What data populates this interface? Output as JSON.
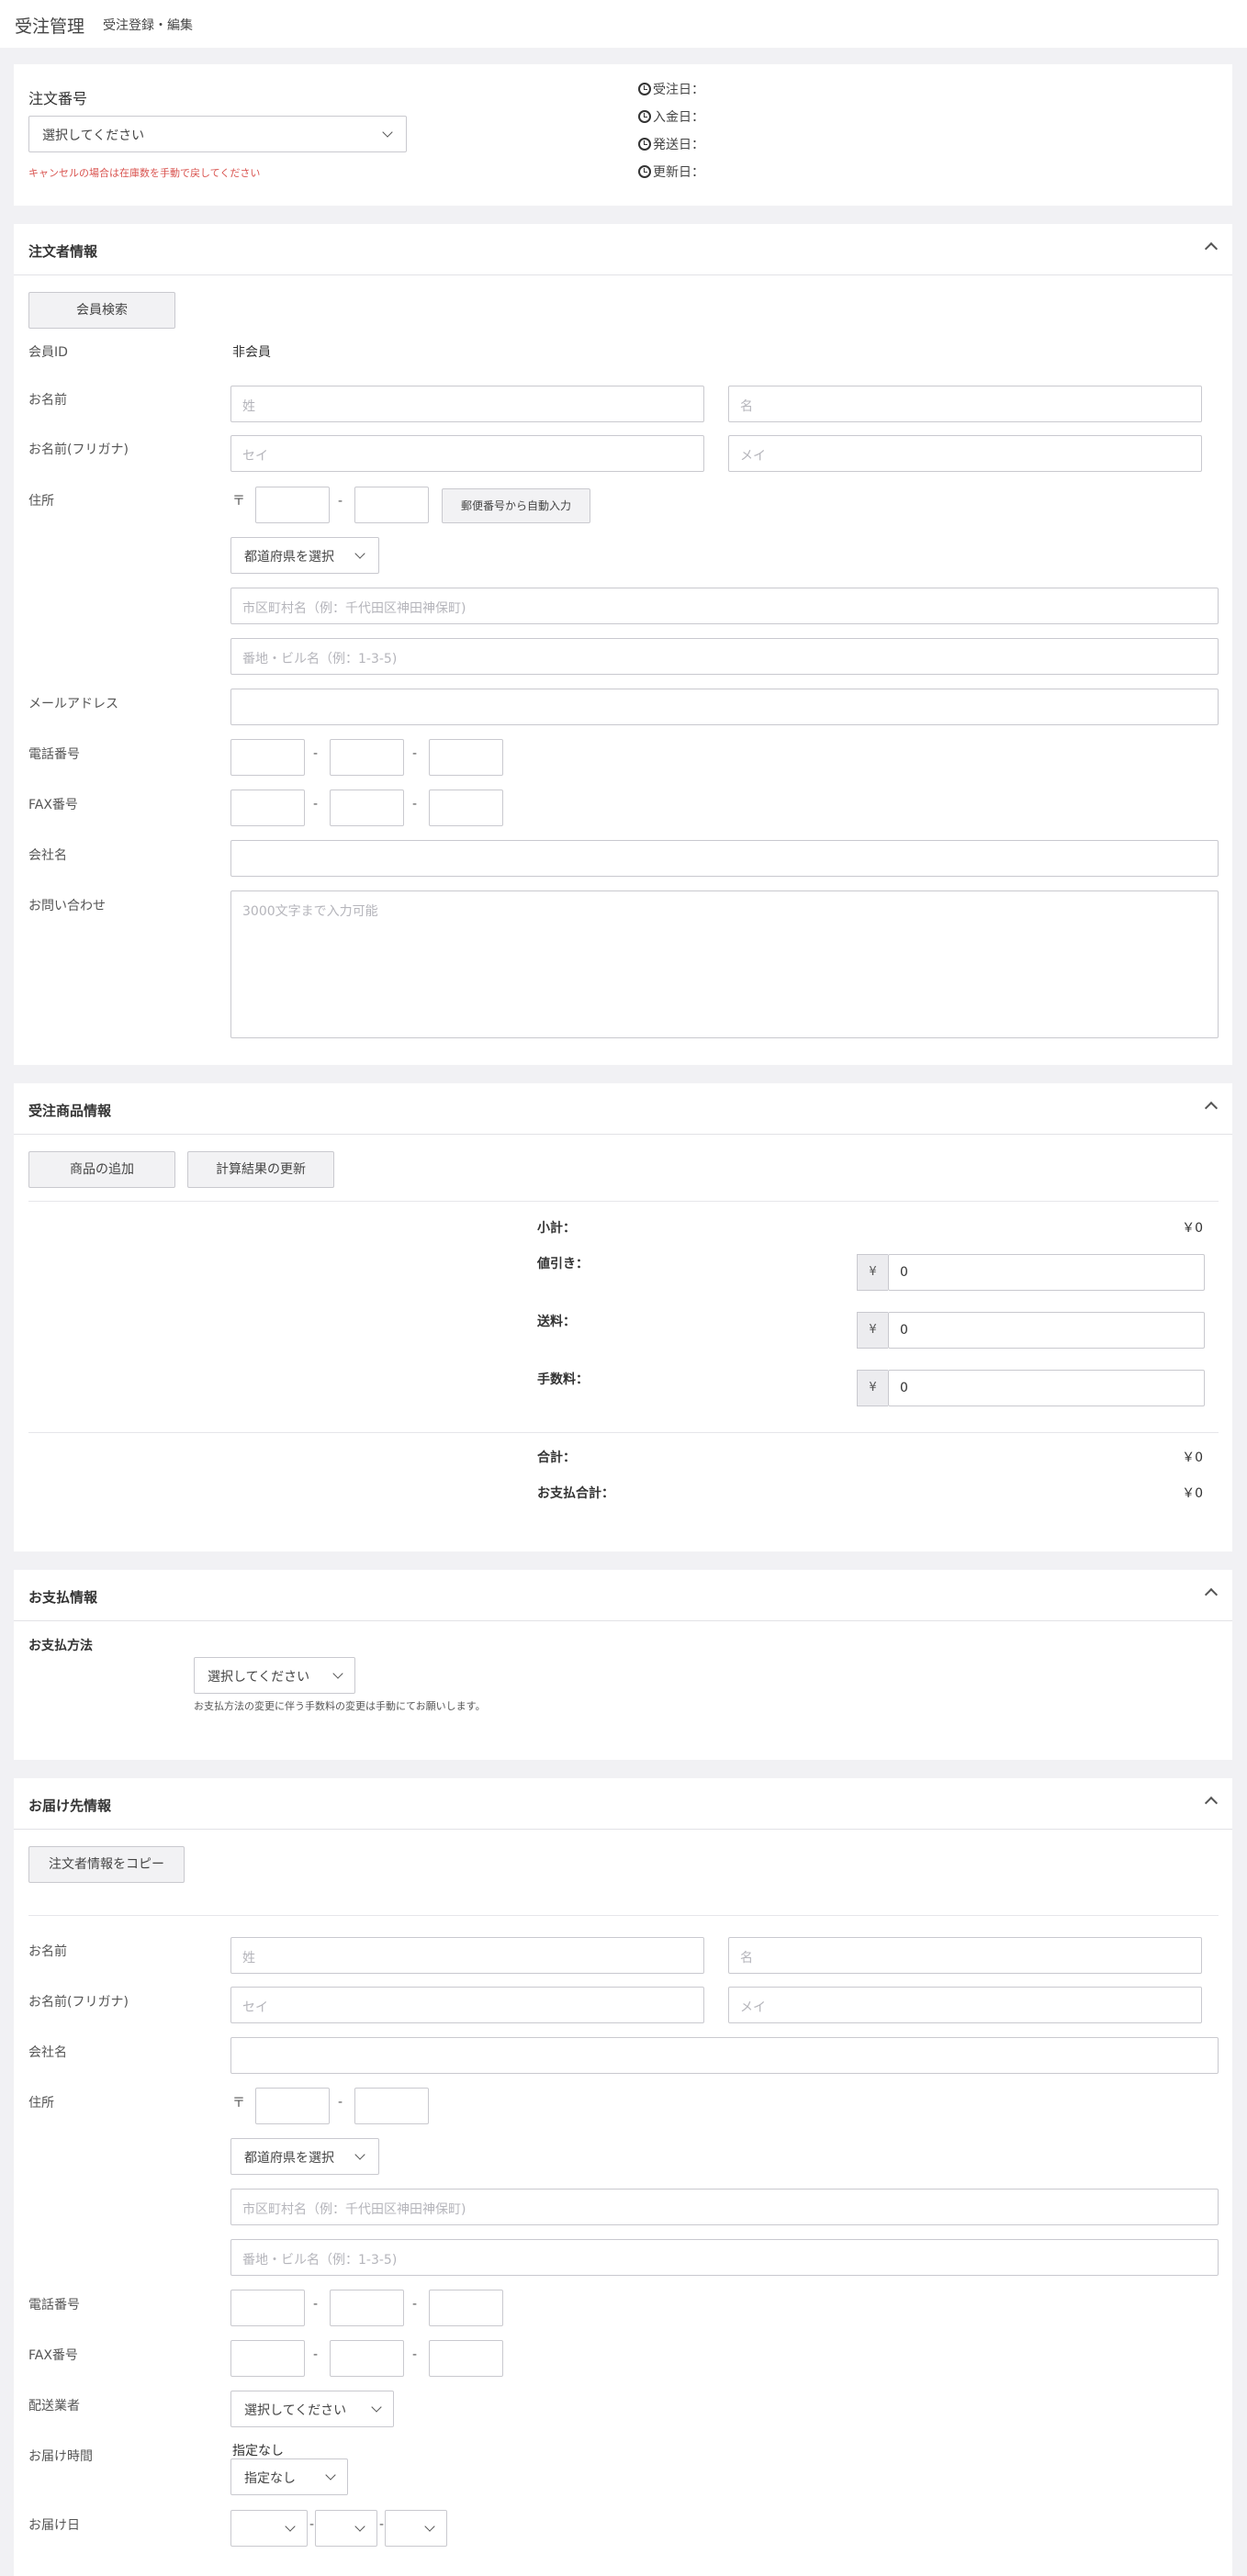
{
  "header": {
    "title": "受注管理",
    "subtitle": "受注登録・編集"
  },
  "order": {
    "label": "注文番号",
    "select": "選択してください",
    "note": "キャンセルの場合は在庫数を手動で戻してください",
    "dates": [
      "受注日：",
      "入金日：",
      "発送日：",
      "更新日："
    ]
  },
  "customer": {
    "title": "注文者情報",
    "search_button": "会員検索",
    "member_id_label": "会員ID",
    "member_id_value": "非会員",
    "name_label": "お名前",
    "last_name_ph": "姓",
    "first_name_ph": "名",
    "kana_label": "お名前(フリガナ)",
    "last_kana_ph": "セイ",
    "first_kana_ph": "メイ",
    "address_label": "住所",
    "postal_mark": "〒",
    "postal_button": "郵便番号から自動入力",
    "pref_select": "都道府県を選択",
    "city_ph": "市区町村名（例：千代田区神田神保町)",
    "addr_ph": "番地・ビル名（例：1-3-5)",
    "email_label": "メールアドレス",
    "tel_label": "電話番号",
    "fax_label": "FAX番号",
    "company_label": "会社名",
    "inquiry_label": "お問い合わせ",
    "inquiry_ph": "3000文字まで入力可能",
    "dash": "-"
  },
  "items": {
    "title": "受注商品情報",
    "add_button": "商品の追加",
    "recalc_button": "計算結果の更新",
    "subtotal_label": "小計：",
    "subtotal_value": "￥0",
    "discount_label": "値引き：",
    "shipping_label": "送料：",
    "fee_label": "手数料：",
    "yen": "¥",
    "discount_value": "0",
    "shipping_value": "0",
    "fee_value": "0",
    "total_label": "合計：",
    "total_value": "￥0",
    "payment_total_label": "お支払合計：",
    "payment_total_value": "￥0"
  },
  "payment": {
    "title": "お支払情報",
    "method_label": "お支払方法",
    "select": "選択してください",
    "note": "お支払方法の変更に伴う手数料の変更は手動にてお願いします。"
  },
  "delivery": {
    "title": "お届け先情報",
    "copy_button": "注文者情報をコピー",
    "name_label": "お名前",
    "last_name_ph": "姓",
    "first_name_ph": "名",
    "kana_label": "お名前(フリガナ)",
    "last_kana_ph": "セイ",
    "first_kana_ph": "メイ",
    "company_label": "会社名",
    "address_label": "住所",
    "postal_mark": "〒",
    "pref_select": "都道府県を選択",
    "city_ph": "市区町村名（例：千代田区神田神保町)",
    "addr_ph": "番地・ビル名（例：1-3-5)",
    "tel_label": "電話番号",
    "fax_label": "FAX番号",
    "carrier_label": "配送業者",
    "carrier_select": "選択してください",
    "time_label": "お届け時間",
    "time_text": "指定なし",
    "time_select": "指定なし",
    "date_label": "お届け日",
    "dash": "-"
  }
}
